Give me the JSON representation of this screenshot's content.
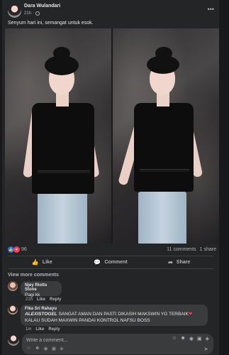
{
  "post": {
    "author": "Dara Wulandari",
    "time": "21h",
    "privacy_separator": "·",
    "text": "Senyum hari ini, semangat untuk esok."
  },
  "stats": {
    "reaction_count": "96",
    "comments": "11 comments",
    "shares": "1 share"
  },
  "actions": {
    "like": "Like",
    "comment": "Comment",
    "share": "Share"
  },
  "view_more": "View more comments",
  "comments": [
    {
      "name": "Njey Riotts Stone",
      "text": "Pagi kk",
      "time": "21h",
      "like": "Like",
      "reply": "Reply"
    },
    {
      "name": "Fika Sri Rahayu",
      "highlight": "ALEXISTOGEL",
      "text_line1": "SANGAT AMAN DAN PASTI DIKASIH MAKSWIN YG TERBAIK",
      "heart": "❤",
      "text_line2": "KALAU SUDAH MAXWIN PANDAI KONTROL NAFSU BOSS",
      "time": "1m",
      "like": "Like",
      "reply": "Reply"
    }
  ],
  "composer": {
    "placeholder": "Write a comment..."
  },
  "icons": {
    "more": "more-icon",
    "like": "thumbs-up-icon",
    "love": "heart-icon",
    "comment": "speech-bubble-icon",
    "share": "share-arrow-icon",
    "send": "send-icon"
  },
  "colors": {
    "background": "#18191a",
    "card": "#242526",
    "bubble": "#3a3b3c",
    "like_blue": "#1877f2",
    "love_red": "#f33e58"
  }
}
